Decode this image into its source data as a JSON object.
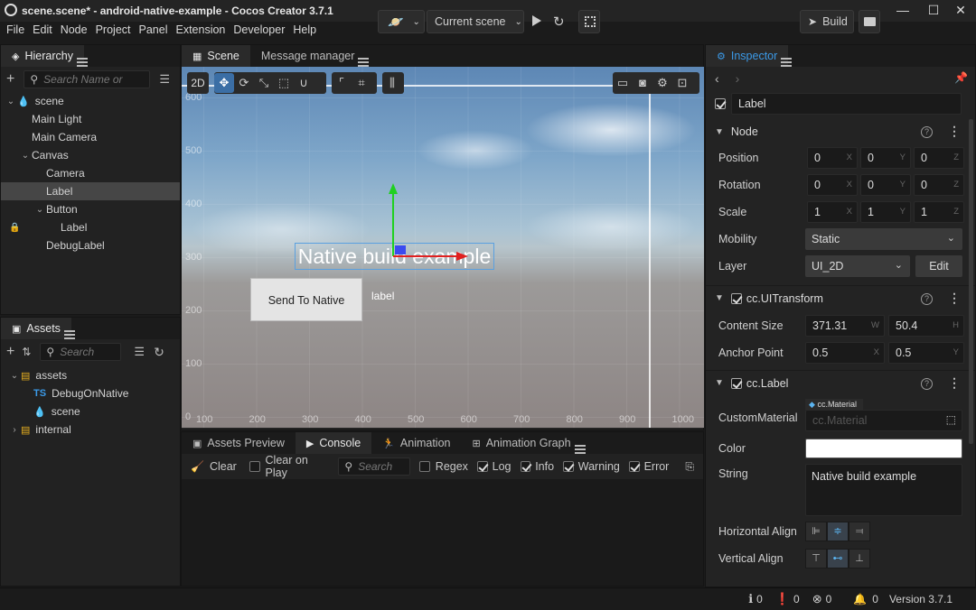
{
  "window": {
    "title": "scene.scene* - android-native-example - Cocos Creator 3.7.1",
    "controls": [
      "minimize",
      "maximize",
      "close"
    ]
  },
  "menu": [
    "File",
    "Edit",
    "Node",
    "Project",
    "Panel",
    "Extension",
    "Developer",
    "Help"
  ],
  "toolbar": {
    "scene_select": "Current scene",
    "build_label": "Build"
  },
  "hierarchy": {
    "tab": "Hierarchy",
    "search_placeholder": "Search Name or",
    "nodes": [
      {
        "label": "scene",
        "depth": 0,
        "expanded": true,
        "icon": "fire-icon"
      },
      {
        "label": "Main Light",
        "depth": 1
      },
      {
        "label": "Main Camera",
        "depth": 1
      },
      {
        "label": "Canvas",
        "depth": 1,
        "expanded": true
      },
      {
        "label": "Camera",
        "depth": 2
      },
      {
        "label": "Label",
        "depth": 2,
        "selected": true
      },
      {
        "label": "Button",
        "depth": 2,
        "expanded": true
      },
      {
        "label": "Label",
        "depth": 3,
        "locked": true
      },
      {
        "label": "DebugLabel",
        "depth": 2
      }
    ]
  },
  "assets": {
    "tab": "Assets",
    "search_placeholder": "Search",
    "items": [
      {
        "label": "assets",
        "depth": 0,
        "expanded": true,
        "icon": "db-icon"
      },
      {
        "label": "DebugOnNative",
        "depth": 1,
        "icon": "ts-icon",
        "badge": "TS"
      },
      {
        "label": "scene",
        "depth": 1,
        "icon": "fire-icon"
      },
      {
        "label": "internal",
        "depth": 0,
        "expanded": false,
        "icon": "db-icon"
      }
    ]
  },
  "scene_panel": {
    "tabs": [
      "Scene",
      "Message manager"
    ],
    "mode_2d": "2D",
    "ruler_y": [
      "600",
      "500",
      "400",
      "300",
      "200",
      "100",
      "0"
    ],
    "ruler_x": [
      "100",
      "200",
      "300",
      "400",
      "500",
      "600",
      "700",
      "800",
      "900",
      "1000"
    ],
    "label_text": "Native build example",
    "button_text": "Send To Native",
    "small_label": "label"
  },
  "bottom_panel": {
    "tabs": [
      "Assets Preview",
      "Console",
      "Animation",
      "Animation Graph"
    ],
    "active_tab": "Console",
    "console": {
      "clear": "Clear",
      "clear_on_play": "Clear on Play",
      "search_placeholder": "Search",
      "regex": "Regex",
      "log": "Log",
      "info": "Info",
      "warning": "Warning",
      "error": "Error"
    }
  },
  "inspector": {
    "tab": "Inspector",
    "node_name": "Label",
    "node_section": "Node",
    "position": {
      "label": "Position",
      "x": "0",
      "y": "0",
      "z": "0"
    },
    "rotation": {
      "label": "Rotation",
      "x": "0",
      "y": "0",
      "z": "0"
    },
    "scale": {
      "label": "Scale",
      "x": "1",
      "y": "1",
      "z": "1"
    },
    "axes": [
      "X",
      "Y",
      "Z"
    ],
    "mobility": {
      "label": "Mobility",
      "value": "Static"
    },
    "layer": {
      "label": "Layer",
      "value": "UI_2D",
      "edit": "Edit"
    },
    "uitransform": {
      "title": "cc.UITransform",
      "content_size": {
        "label": "Content Size",
        "w": "371.31",
        "h": "50.4",
        "w_axis": "W",
        "h_axis": "H"
      },
      "anchor": {
        "label": "Anchor Point",
        "x": "0.5",
        "y": "0.5"
      }
    },
    "label_comp": {
      "title": "cc.Label",
      "custom_material": {
        "label": "CustomMaterial",
        "tag": "cc.Material",
        "placeholder": "cc.Material"
      },
      "color": {
        "label": "Color",
        "value": "#ffffff"
      },
      "string": {
        "label": "String",
        "value": "Native build example"
      },
      "h_align": "Horizontal Align",
      "v_align": "Vertical Align"
    }
  },
  "status": {
    "info_count": "0",
    "warn_count": "0",
    "error_count": "0",
    "notif_count": "0",
    "version": "Version 3.7.1"
  },
  "colors": {
    "accent": "#3b9ae8",
    "gizmo_x": "#e02020",
    "gizmo_y": "#20d020",
    "selection": "#5aa0e0"
  }
}
